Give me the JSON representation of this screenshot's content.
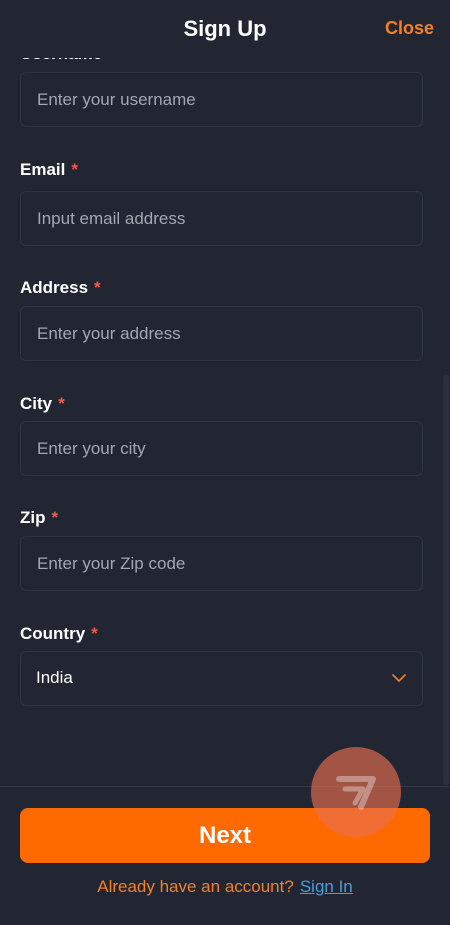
{
  "header": {
    "title": "Sign Up",
    "close_label": "Close"
  },
  "form": {
    "username_label_cut": "Username",
    "username": {
      "placeholder": "Enter your username"
    },
    "email": {
      "label": "Email",
      "required_mark": "*",
      "placeholder": "Input email address"
    },
    "address": {
      "label": "Address",
      "required_mark": "*",
      "placeholder": "Enter your address"
    },
    "city": {
      "label": "City",
      "required_mark": "*",
      "placeholder": "Enter your city"
    },
    "zip": {
      "label": "Zip",
      "required_mark": "*",
      "placeholder": "Enter your Zip code"
    },
    "country": {
      "label": "Country",
      "required_mark": "*",
      "value": "India"
    }
  },
  "footer": {
    "next_label": "Next",
    "signin_prompt": "Already have an account?",
    "signin_link": "Sign In"
  },
  "icons": {
    "dropdown": "chevron-down-icon",
    "badge": "brand-logo-icon"
  },
  "colors": {
    "accent": "#fe6a00",
    "link": "#4a9ed9",
    "required": "#f05a4a",
    "background": "#212632"
  }
}
